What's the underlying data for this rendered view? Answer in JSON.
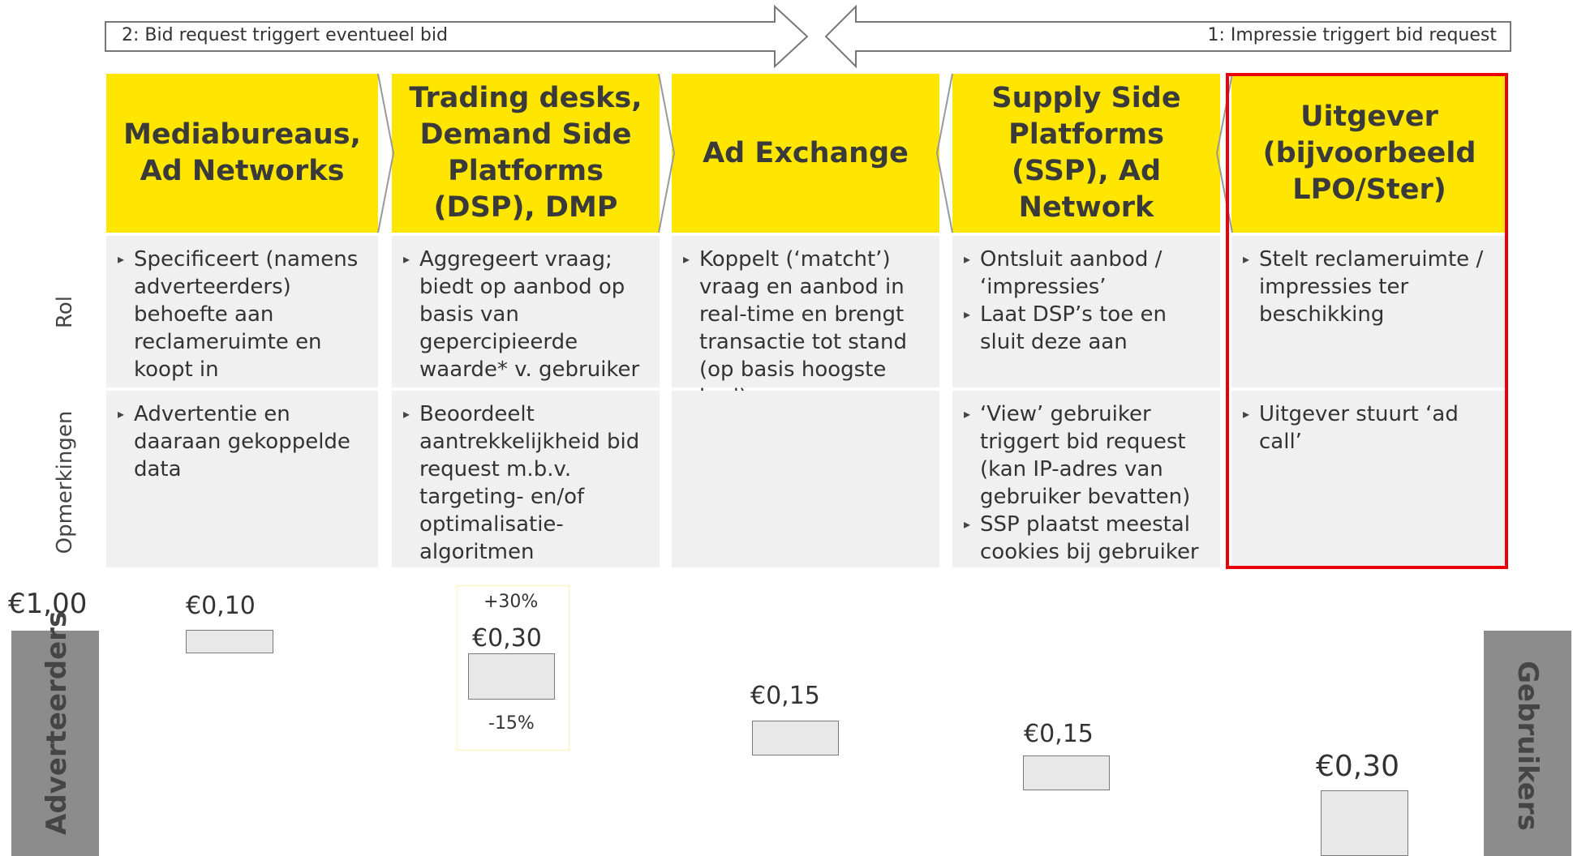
{
  "flow": {
    "left_arrow_label": "2: Bid request triggert eventueel bid",
    "right_arrow_label": "1: Impressie triggert bid request"
  },
  "columns": [
    {
      "title": "Mediabureaus, Ad Networks",
      "rol": [
        "Specificeert (namens adverteerders) behoefte aan reclameruimte en koopt in"
      ],
      "opmerkingen": [
        "Advertentie en daaraan gekoppelde data"
      ]
    },
    {
      "title": "Trading desks, Demand Side Platforms (DSP), DMP",
      "rol": [
        "Aggregeert vraag; biedt op aanbod op basis van gepercipieerde waarde* v. gebruiker"
      ],
      "opmerkingen": [
        "Beoordeelt aantrekkelijkheid bid request m.b.v. targeting- en/of optimalisatie-algoritmen"
      ]
    },
    {
      "title": "Ad Exchange",
      "rol": [
        "Koppelt (‘matcht’) vraag en aanbod in real-time en brengt transactie tot stand (op basis hoogste bod)"
      ],
      "opmerkingen": []
    },
    {
      "title": "Supply Side Platforms (SSP), Ad Network",
      "rol": [
        "Ontsluit aanbod / ‘impressies’",
        "Laat DSP’s toe en sluit deze aan"
      ],
      "opmerkingen": [
        "‘View’ gebruiker triggert bid request (kan IP-adres van gebruiker bevatten)",
        "SSP plaatst meestal cookies bij gebruiker"
      ]
    },
    {
      "title": "Uitgever (bijvoorbeeld LPO/Ster)",
      "rol": [
        "Stelt reclameruimte / impressies ter beschikking"
      ],
      "opmerkingen": [
        "Uitgever stuurt ‘ad call’"
      ]
    }
  ],
  "row_labels": {
    "rol": "Rol",
    "opmerkingen": "Opmerkingen"
  },
  "money": {
    "total": "€1,00",
    "advertisers_label": "Adverteerders",
    "users_label": "Gebruikers",
    "mediabureaus": "€0,10",
    "dsp": "€0,30",
    "dsp_up": "+30%",
    "dsp_down": "-15%",
    "ad_exchange": "€0,15",
    "ssp": "€0,15",
    "uitgever": "€0,30"
  },
  "colors": {
    "header": "#ffe600",
    "cell": "#f0f0f0",
    "highlight": "#e8000b",
    "sidebar": "#8c8c8c"
  }
}
